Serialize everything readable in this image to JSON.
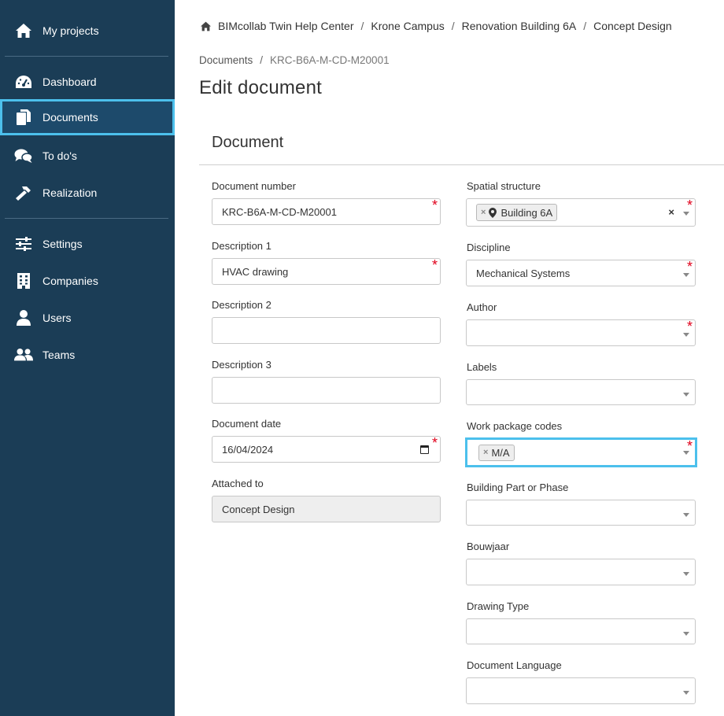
{
  "sidebar": {
    "items": [
      {
        "label": "My projects",
        "icon": "home-icon"
      },
      {
        "label": "Dashboard",
        "icon": "dashboard-icon"
      },
      {
        "label": "Documents",
        "icon": "documents-icon",
        "active": true
      },
      {
        "label": "To do's",
        "icon": "chat-icon"
      },
      {
        "label": "Realization",
        "icon": "hammer-icon"
      },
      {
        "label": "Settings",
        "icon": "sliders-icon"
      },
      {
        "label": "Companies",
        "icon": "building-icon"
      },
      {
        "label": "Users",
        "icon": "user-icon"
      },
      {
        "label": "Teams",
        "icon": "users-icon"
      }
    ],
    "accent": "#4cc0ec",
    "background": "#1b3d56"
  },
  "breadcrumb": [
    "BIMcollab Twin Help Center",
    "Krone Campus",
    "Renovation Building 6A",
    "Concept Design"
  ],
  "sub_breadcrumb": [
    "Documents",
    "KRC-B6A-M-CD-M20001"
  ],
  "page_title": "Edit document",
  "section_title": "Document",
  "left_fields": {
    "document_number": {
      "label": "Document number",
      "value": "KRC-B6A-M-CD-M20001"
    },
    "description_1": {
      "label": "Description 1",
      "value": "HVAC drawing"
    },
    "description_2": {
      "label": "Description 2",
      "value": ""
    },
    "description_3": {
      "label": "Description 3",
      "value": ""
    },
    "document_date": {
      "label": "Document date",
      "value": "16/04/2024"
    },
    "attached_to": {
      "label": "Attached to",
      "value": "Concept Design"
    }
  },
  "right_fields": {
    "spatial_structure": {
      "label": "Spatial structure",
      "tag": "Building 6A"
    },
    "discipline": {
      "label": "Discipline",
      "value": "Mechanical Systems"
    },
    "author": {
      "label": "Author",
      "value": ""
    },
    "labels": {
      "label": "Labels",
      "value": ""
    },
    "work_package_codes": {
      "label": "Work package codes",
      "tag": "M/A"
    },
    "building_part": {
      "label": "Building Part or Phase",
      "value": ""
    },
    "bouwjaar": {
      "label": "Bouwjaar",
      "value": ""
    },
    "drawing_type": {
      "label": "Drawing Type",
      "value": ""
    },
    "document_language": {
      "label": "Document Language",
      "value": ""
    }
  },
  "required_color": "#e0001b"
}
